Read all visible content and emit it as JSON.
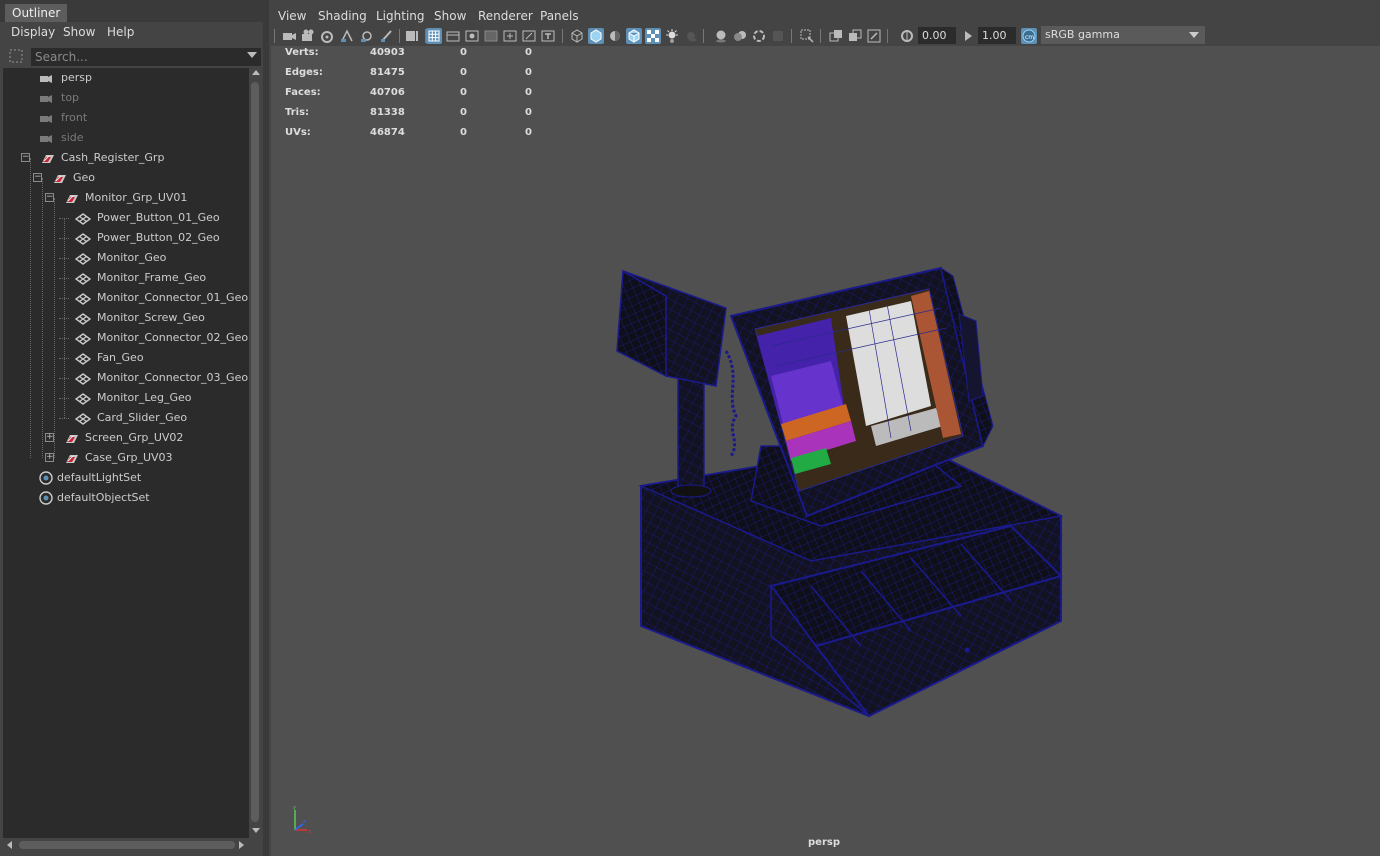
{
  "outliner": {
    "tab_label": "Outliner",
    "menu": [
      "Display",
      "Show",
      "Help"
    ],
    "search_placeholder": "Search...",
    "items": [
      {
        "label": "persp",
        "icon": "camera-icon",
        "dim": false,
        "depth": 0
      },
      {
        "label": "top",
        "icon": "camera-icon",
        "dim": true,
        "depth": 0
      },
      {
        "label": "front",
        "icon": "camera-icon",
        "dim": true,
        "depth": 0
      },
      {
        "label": "side",
        "icon": "camera-icon",
        "dim": true,
        "depth": 0
      },
      {
        "label": "Cash_Register_Grp",
        "icon": "group-icon",
        "dim": false,
        "depth": 0,
        "expander": "collapse"
      },
      {
        "label": "Geo",
        "icon": "group-icon",
        "dim": false,
        "depth": 1,
        "expander": "collapse"
      },
      {
        "label": "Monitor_Grp_UV01",
        "icon": "group-icon",
        "dim": false,
        "depth": 2,
        "expander": "collapse"
      },
      {
        "label": "Power_Button_01_Geo",
        "icon": "mesh-icon",
        "dim": false,
        "depth": 3
      },
      {
        "label": "Power_Button_02_Geo",
        "icon": "mesh-icon",
        "dim": false,
        "depth": 3
      },
      {
        "label": "Monitor_Geo",
        "icon": "mesh-icon",
        "dim": false,
        "depth": 3
      },
      {
        "label": "Monitor_Frame_Geo",
        "icon": "mesh-icon",
        "dim": false,
        "depth": 3
      },
      {
        "label": "Monitor_Connector_01_Geo",
        "icon": "mesh-icon",
        "dim": false,
        "depth": 3
      },
      {
        "label": "Monitor_Screw_Geo",
        "icon": "mesh-icon",
        "dim": false,
        "depth": 3
      },
      {
        "label": "Monitor_Connector_02_Geo",
        "icon": "mesh-icon",
        "dim": false,
        "depth": 3
      },
      {
        "label": "Fan_Geo",
        "icon": "mesh-icon",
        "dim": false,
        "depth": 3
      },
      {
        "label": "Monitor_Connector_03_Geo",
        "icon": "mesh-icon",
        "dim": false,
        "depth": 3
      },
      {
        "label": "Monitor_Leg_Geo",
        "icon": "mesh-icon",
        "dim": false,
        "depth": 3
      },
      {
        "label": "Card_Slider_Geo",
        "icon": "mesh-icon",
        "dim": false,
        "depth": 3
      },
      {
        "label": "Screen_Grp_UV02",
        "icon": "group-icon",
        "dim": false,
        "depth": 2,
        "expander": "expand"
      },
      {
        "label": "Case_Grp_UV03",
        "icon": "group-icon",
        "dim": false,
        "depth": 2,
        "expander": "expand"
      },
      {
        "label": "defaultLightSet",
        "icon": "set-icon",
        "dim": false,
        "depth": 0
      },
      {
        "label": "defaultObjectSet",
        "icon": "set-icon",
        "dim": false,
        "depth": 0
      }
    ]
  },
  "viewport": {
    "menu": [
      "View",
      "Shading",
      "Lighting",
      "Show",
      "Renderer",
      "Panels"
    ],
    "toolbar": {
      "exposure": "0.00",
      "gamma": "1.00",
      "color_space": "sRGB gamma"
    },
    "hud": [
      {
        "label": "Verts:",
        "v1": "40903",
        "v2": "0",
        "v3": "0"
      },
      {
        "label": "Edges:",
        "v1": "81475",
        "v2": "0",
        "v3": "0"
      },
      {
        "label": "Faces:",
        "v1": "40706",
        "v2": "0",
        "v3": "0"
      },
      {
        "label": "Tris:",
        "v1": "81338",
        "v2": "0",
        "v3": "0"
      },
      {
        "label": "UVs:",
        "v1": "46874",
        "v2": "0",
        "v3": "0"
      }
    ],
    "camera_name": "persp",
    "colors": {
      "background": "#505050",
      "wireframe": "#1a1a8c",
      "mesh": "#111111"
    }
  }
}
